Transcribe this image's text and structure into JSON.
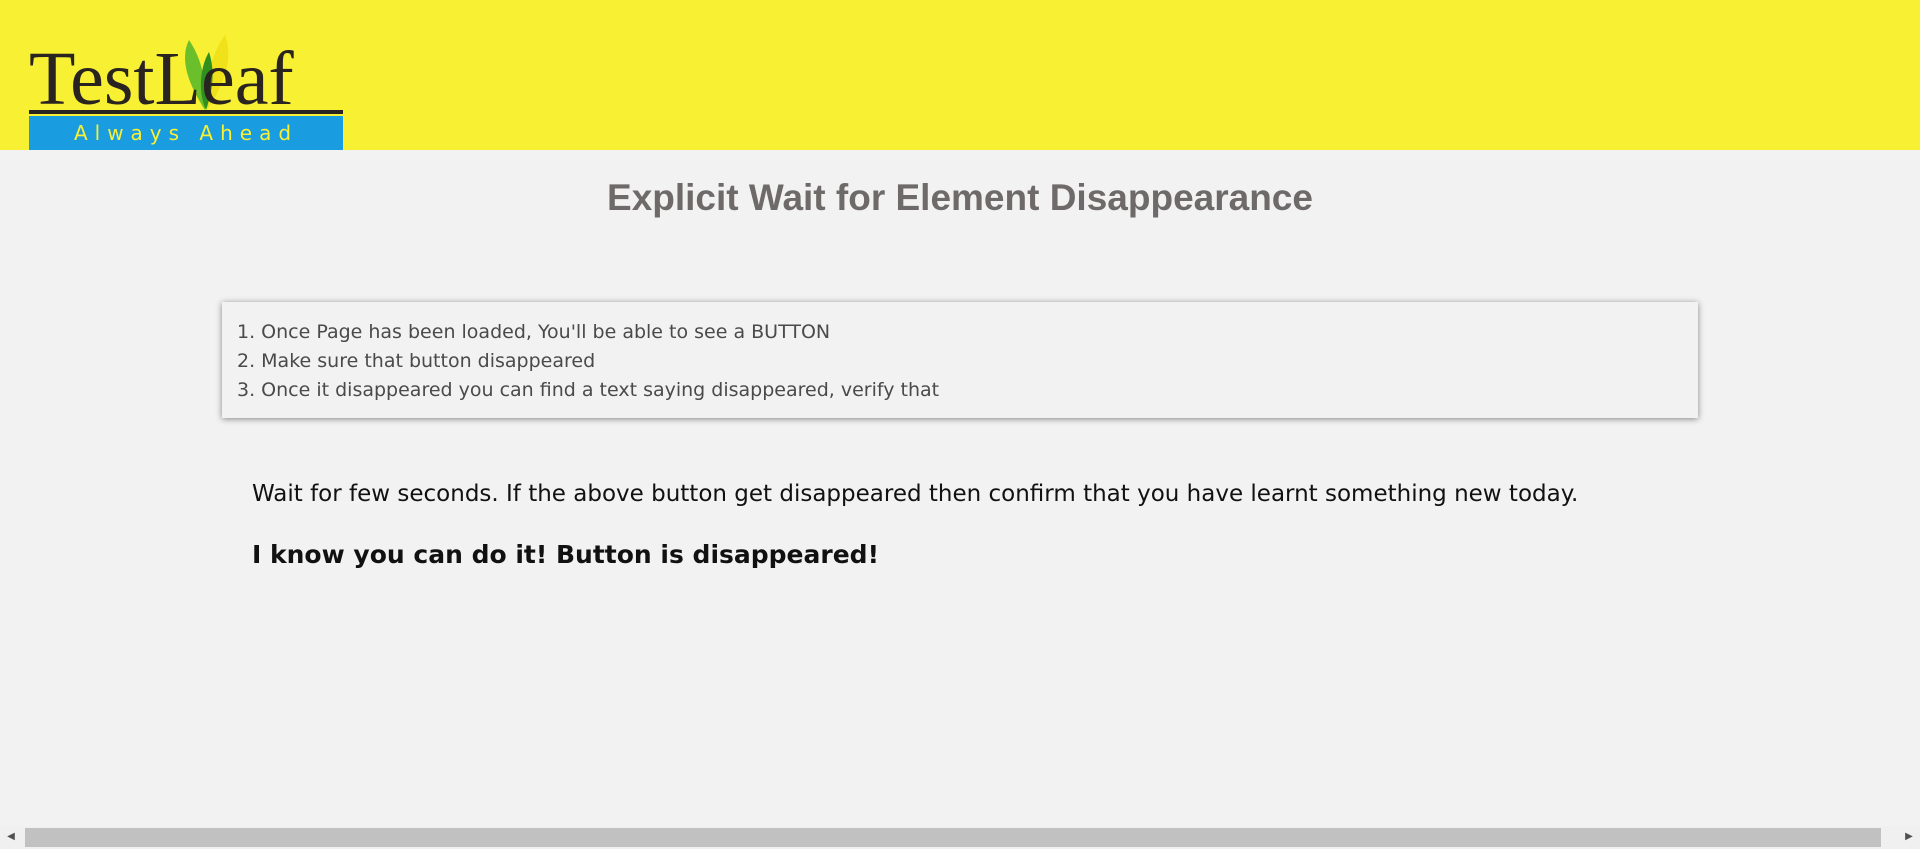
{
  "header": {
    "logo_word": "TestLeaf",
    "logo_tagline": "Always Ahead"
  },
  "page_title": "Explicit Wait for Element Disappearance",
  "instructions": [
    "1. Once Page has been loaded, You'll be able to see a BUTTON",
    "2. Make sure that button disappeared",
    "3. Once it disappeared you can find a text saying disappeared, verify that"
  ],
  "wait_text": "Wait for few seconds. If the above button get disappeared then confirm that you have learnt something new today.",
  "result_text": "I know you can do it! Button is disappeared!",
  "scrollbar": {
    "left_arrow_icon": "◀",
    "right_arrow_icon": "▶"
  },
  "colors": {
    "header_bg": "#f7f033",
    "tagline_bg": "#1a9ce0",
    "title": "#6f6a6a"
  }
}
